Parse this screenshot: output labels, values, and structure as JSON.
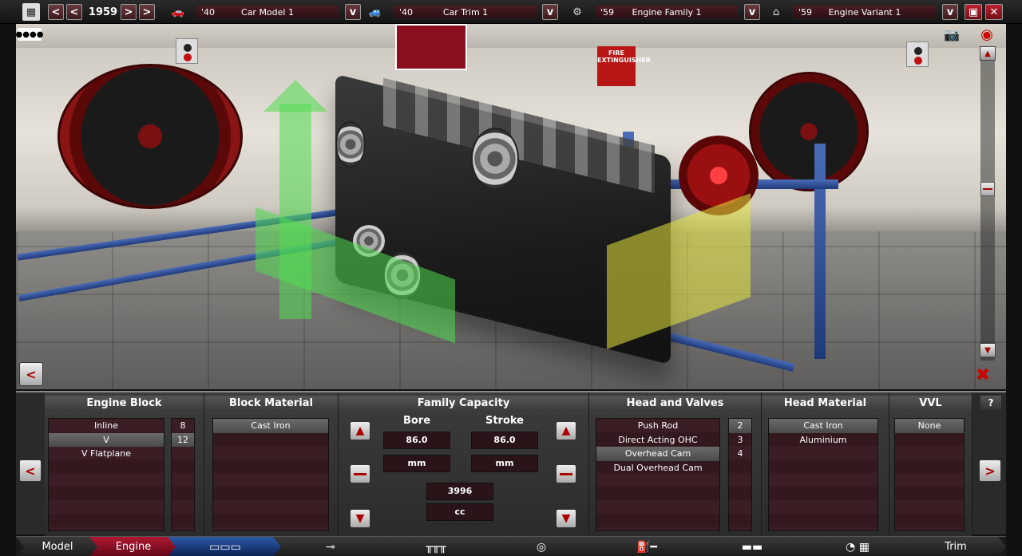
{
  "topbar": {
    "year": "1959",
    "car_model": {
      "year": "'40",
      "name": "Car Model 1"
    },
    "car_trim": {
      "year": "'40",
      "name": "Car Trim 1"
    },
    "engine_family": {
      "year": "'59",
      "name": "Engine Family 1"
    },
    "engine_variant": {
      "year": "'59",
      "name": "Engine Variant 1"
    },
    "prev": "<",
    "next": ">",
    "dropdown": "v",
    "icons": [
      "calendar-icon",
      "car-icon",
      "car-trim-icon",
      "engine-block-icon",
      "engine-variant-icon",
      "save-icon",
      "close-icon"
    ]
  },
  "viewport": {
    "fire_sign": "FIRE EXTINGUISHER",
    "left_button": "<"
  },
  "panel": {
    "engine_block": {
      "title": "Engine Block",
      "types": [
        "Inline",
        "V",
        "V Flatplane"
      ],
      "selected_type": 1,
      "cylinders": [
        "8",
        "12"
      ],
      "selected_cylinders": 1
    },
    "block_material": {
      "title": "Block Material",
      "items": [
        "Cast Iron"
      ],
      "selected": 0
    },
    "family_capacity": {
      "title": "Family Capacity",
      "bore_label": "Bore",
      "stroke_label": "Stroke",
      "bore_value": "86.0",
      "stroke_value": "86.0",
      "bore_unit": "mm",
      "stroke_unit": "mm",
      "capacity_value": "3996",
      "capacity_unit": "cc"
    },
    "head_valves": {
      "title": "Head and Valves",
      "items": [
        "Push Rod",
        "Direct Acting OHC",
        "Overhead Cam",
        "Dual Overhead Cam"
      ],
      "selected": 2,
      "valves": [
        "2",
        "3",
        "4"
      ],
      "selected_valves": 0
    },
    "head_material": {
      "title": "Head Material",
      "items": [
        "Cast Iron",
        "Aluminium"
      ],
      "selected": 0
    },
    "vvl": {
      "title": "VVL",
      "items": [
        "None"
      ],
      "selected": 0
    },
    "help": "?",
    "prev": "<",
    "next": ">"
  },
  "bottomnav": {
    "model": "Model",
    "engine": "Engine",
    "trim": "Trim"
  },
  "colors": {
    "accent_red": "#b01830",
    "nav_blue": "#2a5aa8",
    "list_bg": "#3a1e24",
    "rail_blue": "#4a6cb8"
  }
}
